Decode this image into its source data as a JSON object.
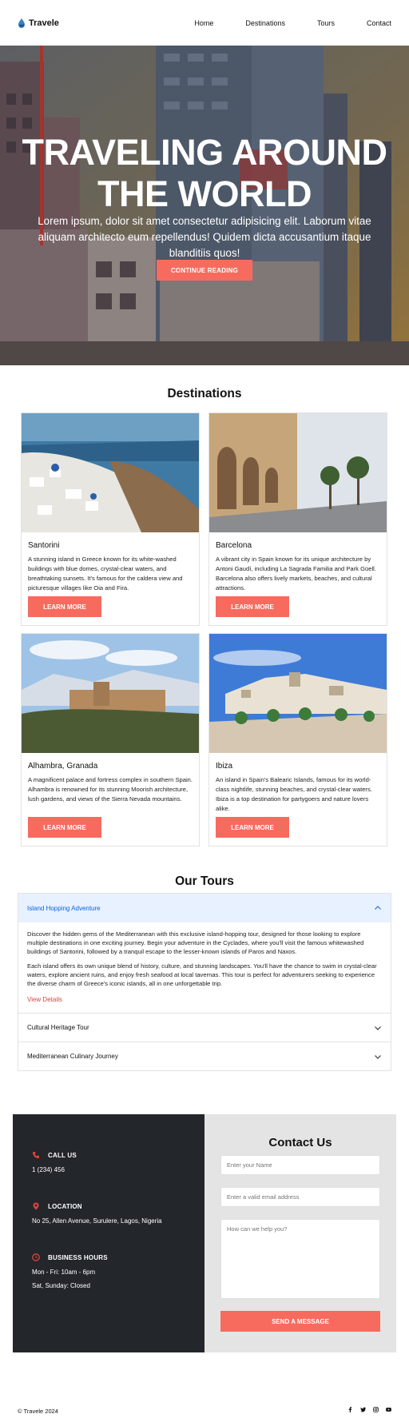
{
  "nav": {
    "brand": "Travele",
    "links": [
      "Home",
      "Destinations",
      "Tours",
      "Contact"
    ]
  },
  "hero": {
    "title_line1": "TRAVELING AROUND",
    "title_line2": "THE WORLD",
    "text": "Lorem ipsum, dolor sit amet consectetur adipisicing elit. Laborum vitae aliquam architecto eum repellendus! Quidem dicta accusantium itaque blanditiis quos!",
    "button": "CONTINUE READING"
  },
  "destinations": {
    "title": "Destinations",
    "cards": [
      {
        "name": "Santorini",
        "desc": "A stunning island in Greece known for its white-washed buildings with blue domes, crystal-clear waters, and breathtaking sunsets. It's famous for the caldera view and picturesque villages like Oia and Fira.",
        "button": "LEARN MORE"
      },
      {
        "name": "Barcelona",
        "desc": "A vibrant city in Spain known for its unique architecture by Antoni Gaudí, including La Sagrada Familia and Park Güell. Barcelona also offers lively markets, beaches, and cultural attractions.",
        "button": "LEARN MORE"
      },
      {
        "name": "Alhambra, Granada",
        "desc": "A magnificent palace and fortress complex in southern Spain. Alhambra is renowned for its stunning Moorish architecture, lush gardens, and views of the Sierra Nevada mountains.",
        "button": "LEARN MORE"
      },
      {
        "name": "Ibiza",
        "desc": "An island in Spain's Balearic Islands, famous for its world-class nightlife, stunning beaches, and crystal-clear waters. Ibiza is a top destination for partygoers and nature lovers alike.",
        "button": "LEARN MORE"
      }
    ]
  },
  "tours": {
    "title": "Our Tours",
    "items": [
      {
        "title": "Island Hopping Adventure",
        "open": true,
        "p1": "Discover the hidden gems of the Mediterranean with this exclusive island-hopping tour, designed for those looking to explore multiple destinations in one exciting journey. Begin your adventure in the Cyclades, where you'll visit the famous whitewashed buildings of Santorini, followed by a tranquil escape to the lesser-known islands of Paros and Naxos.",
        "p2": "Each island offers its own unique blend of history, culture, and stunning landscapes. You'll have the chance to swim in crystal-clear waters, explore ancient ruins, and enjoy fresh seafood at local tavernas. This tour is perfect for adventurers seeking to experience the diverse charm of Greece's iconic islands, all in one unforgettable trip.",
        "link": "View Details"
      },
      {
        "title": "Cultural Heritage Tour",
        "open": false
      },
      {
        "title": "Mediterranean Culinary Journey",
        "open": false
      }
    ]
  },
  "contact": {
    "call_label": "CALL US",
    "call_value": "1 (234) 456",
    "location_label": "LOCATION",
    "location_value": "No 25, Allen Avenue, Surulere, Lagos, Nigeria",
    "hours_label": "BUSINESS HOURS",
    "hours_weekday": "Mon - Fri: 10am - 6pm",
    "hours_weekend": "Sat, Sunday: Closed",
    "title": "Contact Us",
    "name_placeholder": "Enter your Name",
    "email_placeholder": "Enter a valid email address",
    "message_placeholder": "How can we help you?",
    "send_button": "SEND A MESSAGE"
  },
  "footer": {
    "copyright": "© Travele 2024",
    "socials": [
      "facebook-icon",
      "twitter-icon",
      "instagram-icon",
      "youtube-icon"
    ]
  },
  "colors": {
    "accent": "#f76b5f",
    "dark_panel": "#23262b",
    "light_panel": "#e4e4e4",
    "active_tab_bg": "#e7f1ff",
    "active_tab_text": "#0c63e4",
    "link_red": "#e0433a"
  }
}
